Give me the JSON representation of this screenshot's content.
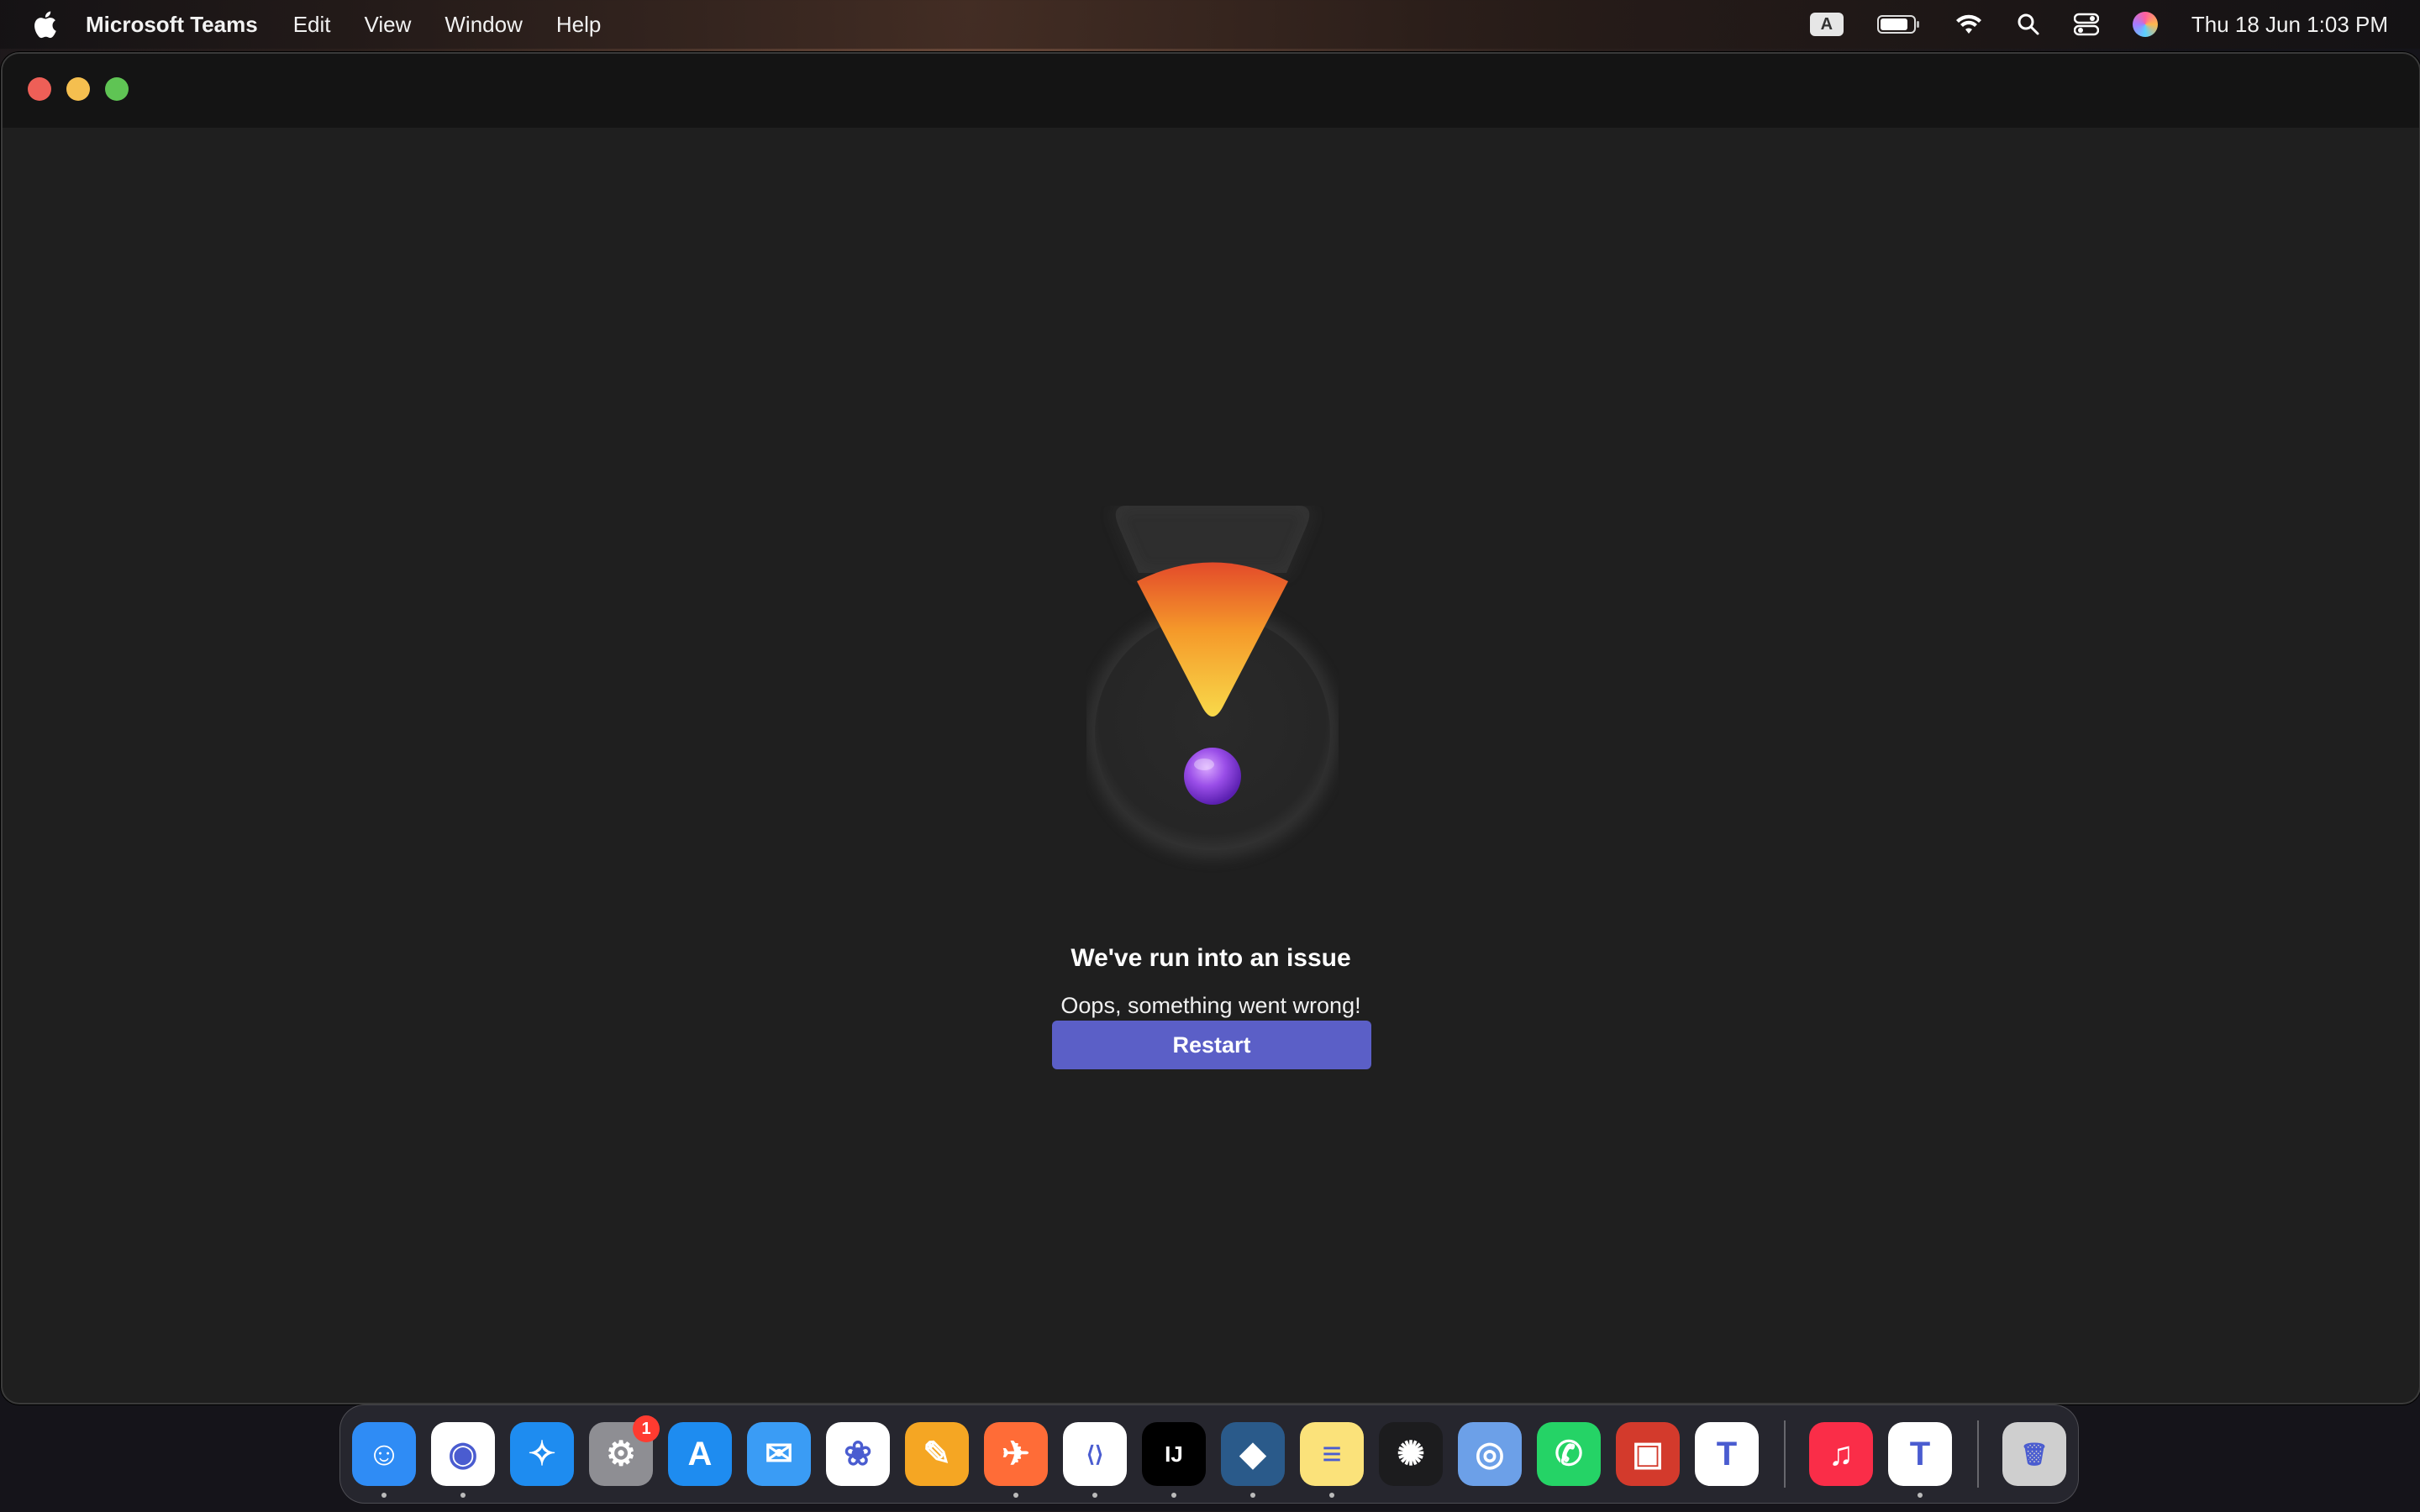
{
  "menubar": {
    "app_name": "Microsoft Teams",
    "items": [
      "Edit",
      "View",
      "Window",
      "Help"
    ],
    "input_badge": "A",
    "clock": "Thu 18 Jun  1:03 PM"
  },
  "error": {
    "title": "We've run into an issue",
    "subtitle": "Oops, something went wrong!",
    "button_label": "Restart"
  },
  "dock": {
    "apps": [
      {
        "name": "finder",
        "color": "#2f8cf5",
        "glyph": "☺"
      },
      {
        "name": "chrome",
        "color": "#ffffff",
        "glyph": "◉"
      },
      {
        "name": "safari",
        "color": "#1e8cf0",
        "glyph": "✧"
      },
      {
        "name": "system-settings",
        "color": "#8e8e93",
        "glyph": "⚙",
        "badge": "1"
      },
      {
        "name": "app-store",
        "color": "#1e8cf0",
        "glyph": "A"
      },
      {
        "name": "mail",
        "color": "#3a9cf5",
        "glyph": "✉"
      },
      {
        "name": "photos",
        "color": "#ffffff",
        "glyph": "❀"
      },
      {
        "name": "pages",
        "color": "#f5a623",
        "glyph": "✎"
      },
      {
        "name": "postman",
        "color": "#ff6c37",
        "glyph": "✈"
      },
      {
        "name": "vscode",
        "color": "#ffffff",
        "glyph": "⟨⟩"
      },
      {
        "name": "intellij",
        "color": "#000000",
        "glyph": "IJ"
      },
      {
        "name": "mysql-workbench",
        "color": "#2a5a8a",
        "glyph": "◆"
      },
      {
        "name": "notes",
        "color": "#fbe27a",
        "glyph": "≡"
      },
      {
        "name": "ai-app",
        "color": "#1c1c1e",
        "glyph": "✺"
      },
      {
        "name": "preview",
        "color": "#6ca0e8",
        "glyph": "◎"
      },
      {
        "name": "whatsapp",
        "color": "#25d366",
        "glyph": "✆"
      },
      {
        "name": "photo-booth",
        "color": "#d33a2c",
        "glyph": "▣"
      },
      {
        "name": "teams-classic",
        "color": "#ffffff",
        "glyph": "T"
      }
    ],
    "recent_apps": [
      {
        "name": "music",
        "color": "#fa2d48",
        "glyph": "♫"
      },
      {
        "name": "teams",
        "color": "#ffffff",
        "glyph": "T"
      }
    ],
    "trash": {
      "name": "trash",
      "color": "#cfcfcf",
      "glyph": "🗑"
    }
  }
}
